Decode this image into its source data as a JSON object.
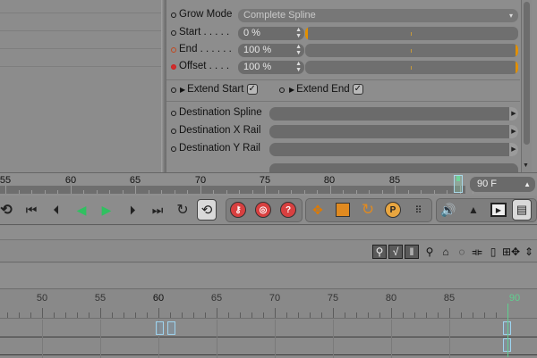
{
  "attributes": {
    "grow_mode": {
      "label": "Grow Mode",
      "value": "Complete Spline"
    },
    "start": {
      "label": "Start . . . . .",
      "value": "0 %",
      "slider_fraction": 0.0
    },
    "end": {
      "label": "End . . . . . .",
      "value": "100 %",
      "slider_fraction": 1.0
    },
    "offset": {
      "label": "Offset . . . .",
      "value": "100 %",
      "slider_fraction": 1.0
    },
    "extend_start": {
      "label": "Extend Start",
      "checked": true
    },
    "extend_end": {
      "label": "Extend End",
      "checked": true
    },
    "destination_spline": {
      "label": "Destination Spline"
    },
    "destination_x_rail": {
      "label": "Destination X Rail"
    },
    "destination_y_rail": {
      "label": "Destination Y Rail"
    }
  },
  "ruler": {
    "labels": [
      "55",
      "60",
      "65",
      "70",
      "75",
      "80",
      "85"
    ],
    "current_frame": "90 F"
  },
  "transport": {
    "icons": [
      "loop-icon",
      "go-to-start-icon",
      "previous-key-icon",
      "play-backward-icon",
      "play-forward-icon",
      "next-key-icon",
      "go-to-end-icon",
      "loop-toggle-icon",
      "loop-mode-icon",
      "record-icon",
      "autokey-icon",
      "keyframe-selection-icon",
      "move-icon",
      "scale-icon",
      "rotate-icon",
      "param-icon",
      "point-level-icon",
      "sound-icon",
      "render-preview-icon",
      "render-view-icon",
      "render-settings-icon"
    ]
  },
  "timeline": {
    "labels": [
      "50",
      "55",
      "60",
      "65",
      "70",
      "75",
      "80",
      "85",
      "90"
    ],
    "current": "60",
    "end_label": "90"
  },
  "colors": {
    "accent_green": "#5fd08f",
    "slider_knob": "#e29000",
    "key_outline": "#9ed4ef"
  }
}
